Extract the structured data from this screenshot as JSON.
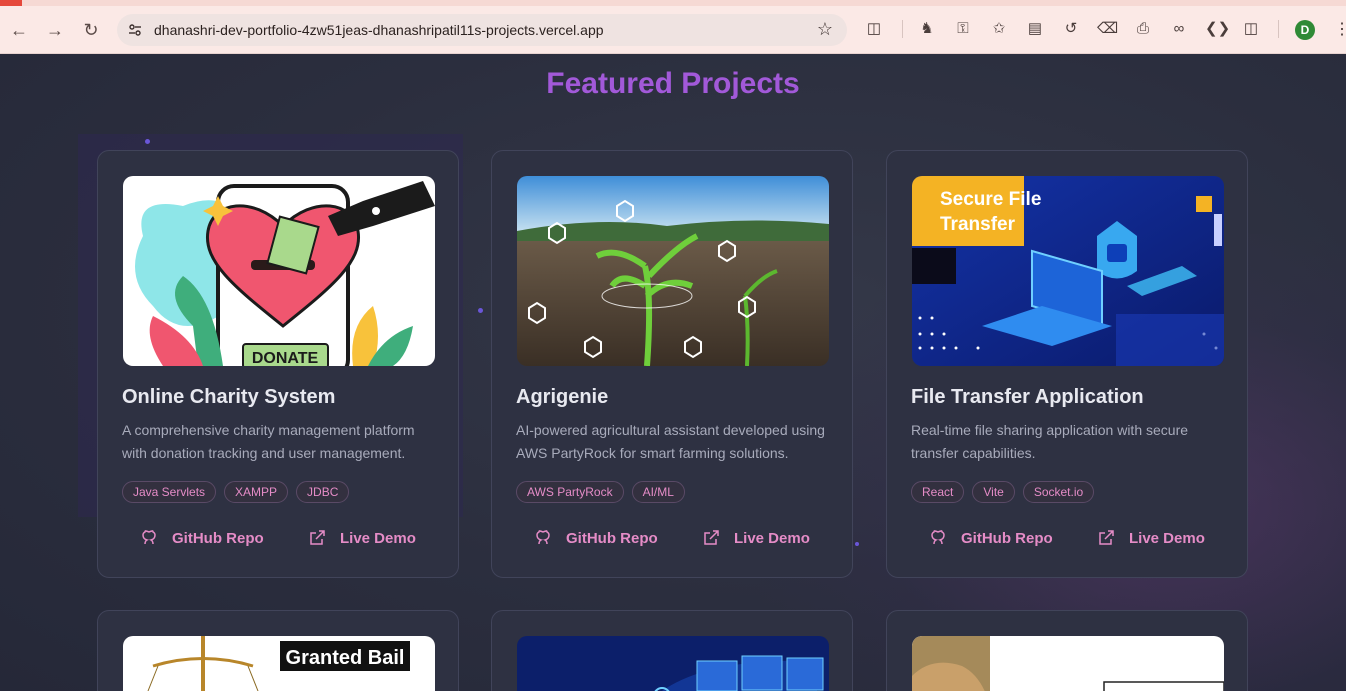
{
  "browser": {
    "url": "dhanashri-dev-portfolio-4zw51jeas-dhanashripatil11s-projects.vercel.app",
    "profile_initial": "D",
    "icons": [
      "back-icon",
      "forward-icon",
      "reload-icon",
      "site-info-icon",
      "bookmark-star-icon",
      "extensions-icon",
      "incognito-icon",
      "password-key-icon",
      "favorites-icon",
      "reading-list-icon",
      "history-icon",
      "delete-icon",
      "print-icon",
      "copy-link-icon",
      "devtools-icon",
      "side-panel-icon",
      "menu-icon"
    ]
  },
  "section": {
    "title": "Featured Projects"
  },
  "projects": [
    {
      "title": "Online Charity System",
      "description": "A comprehensive charity management platform with donation tracking and user management.",
      "tags": [
        "Java Servlets",
        "XAMPP",
        "JDBC"
      ],
      "github_label": "GitHub Repo",
      "demo_label": "Live Demo",
      "image_text": "DONATE"
    },
    {
      "title": "Agrigenie",
      "description": "AI-powered agricultural assistant developed using AWS PartyRock for smart farming solutions.",
      "tags": [
        "AWS PartyRock",
        "AI/ML"
      ],
      "github_label": "GitHub Repo",
      "demo_label": "Live Demo"
    },
    {
      "title": "File Transfer Application",
      "description": "Real-time file sharing application with secure transfer capabilities.",
      "tags": [
        "React",
        "Vite",
        "Socket.io"
      ],
      "github_label": "GitHub Repo",
      "demo_label": "Live Demo",
      "image_text": "Secure File Transfer"
    }
  ],
  "next_row": {
    "first_image_text": "Granted Bail"
  },
  "colors": {
    "accent_title": "#a259d9",
    "link_pink": "#e58cc7",
    "card_bg": "#2e3142",
    "page_bg": "#2b2e3e"
  }
}
